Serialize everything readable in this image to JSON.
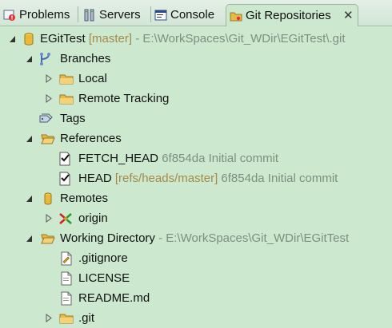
{
  "tabs": [
    {
      "label": "Problems",
      "icon": "problems-icon",
      "active": false
    },
    {
      "label": "Servers",
      "icon": "servers-icon",
      "active": false
    },
    {
      "label": "Console",
      "icon": "console-icon",
      "active": false
    },
    {
      "label": "Git Repositories",
      "icon": "git-repositories-icon",
      "active": true,
      "close": "✕"
    }
  ],
  "tree": {
    "repo": {
      "name": "EGitTest",
      "branch": "[master]",
      "path": "- E:\\WorkSpaces\\Git_WDir\\EGitTest\\.git"
    },
    "branches": {
      "label": "Branches",
      "children": [
        "Local",
        "Remote Tracking"
      ]
    },
    "tags": {
      "label": "Tags"
    },
    "references": {
      "label": "References",
      "items": [
        {
          "name": "FETCH_HEAD",
          "ref": "",
          "commit": "6f854da Initial commit"
        },
        {
          "name": "HEAD",
          "ref": "[refs/heads/master]",
          "commit": "6f854da Initial commit"
        }
      ]
    },
    "remotes": {
      "label": "Remotes",
      "children": [
        "origin"
      ]
    },
    "working_directory": {
      "label": "Working Directory",
      "path": "- E:\\WorkSpaces\\Git_WDir\\EGitTest",
      "files": [
        ".gitignore",
        "LICENSE",
        "README.md"
      ],
      "folders": [
        ".git"
      ]
    }
  },
  "colors": {
    "background": "#cce8cf",
    "muted_text": "#7d8f80",
    "branch_ref": "#a58a4a",
    "folder": "#e7b949"
  }
}
